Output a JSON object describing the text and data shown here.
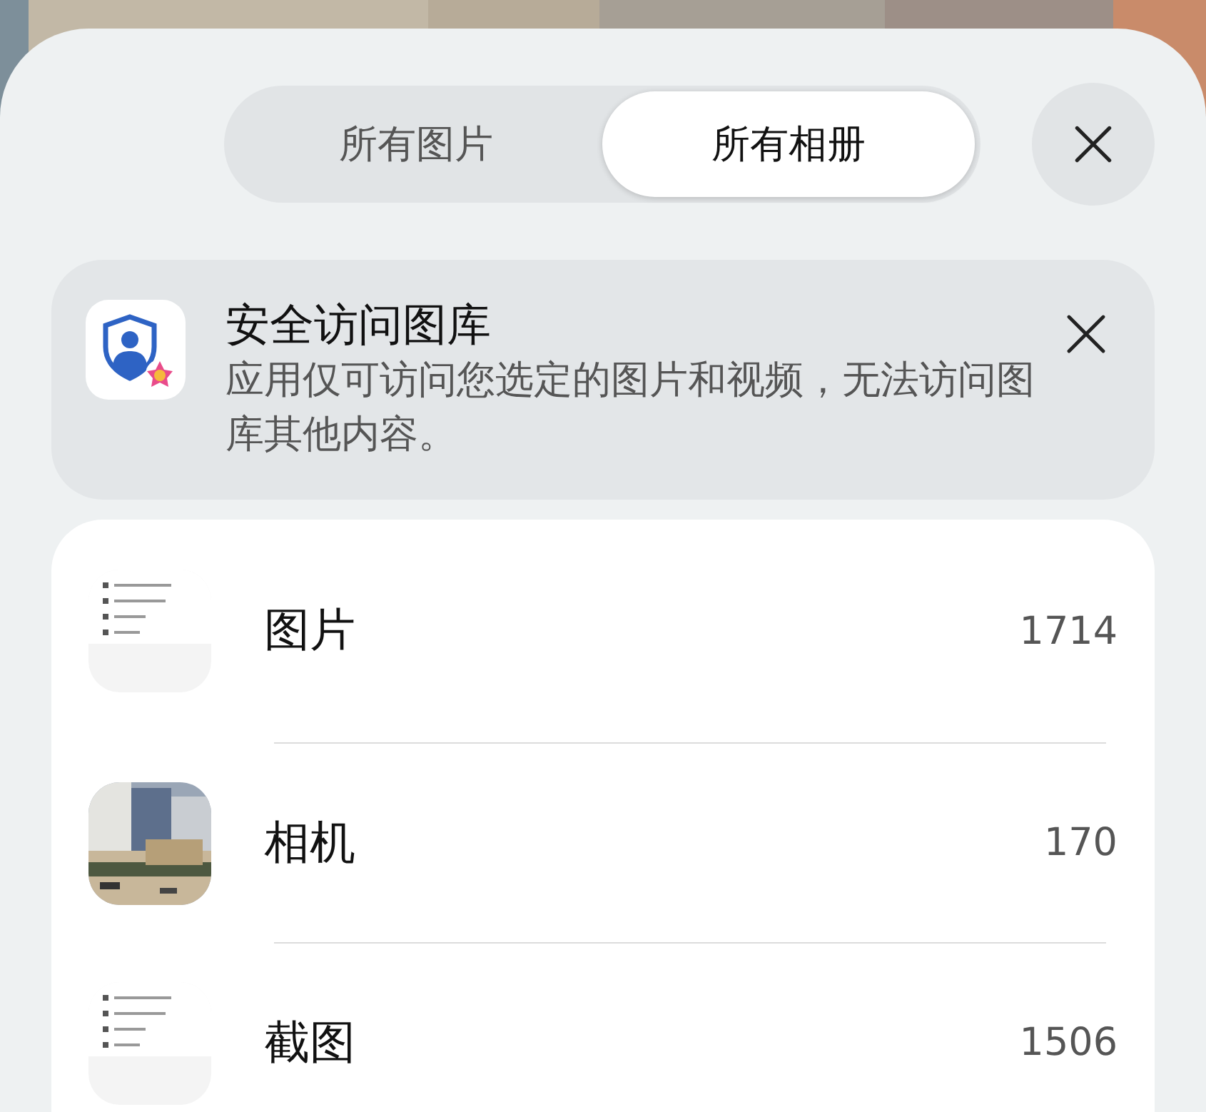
{
  "tabs": [
    {
      "label": "所有图片",
      "selected": false
    },
    {
      "label": "所有相册",
      "selected": true
    }
  ],
  "notice": {
    "title": "安全访问图库",
    "text": "应用仅可访问您选定的图片和视频，无法访问图库其他内容。"
  },
  "albums": [
    {
      "name": "图片",
      "count": "1714",
      "kind": "screenshot"
    },
    {
      "name": "相机",
      "count": "170"
    },
    {
      "name": "截图",
      "count": "1506",
      "kind": "screenshot"
    }
  ]
}
